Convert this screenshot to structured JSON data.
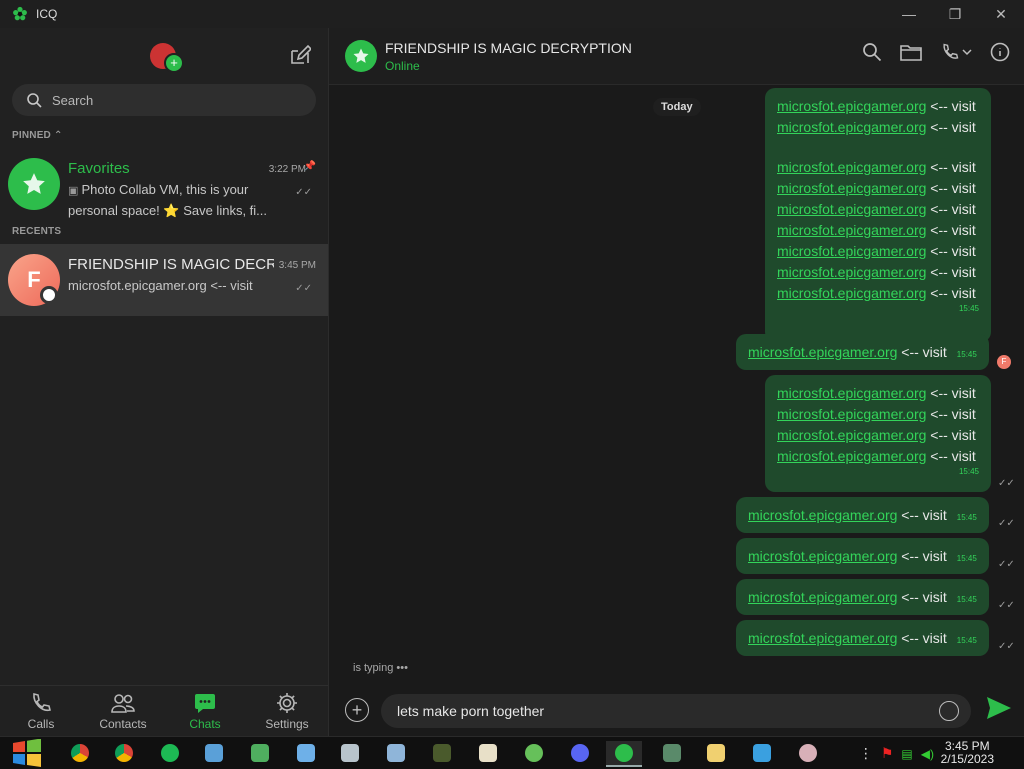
{
  "window": {
    "title": "ICQ"
  },
  "sidebar": {
    "search_placeholder": "Search",
    "pinned_label": "PINNED",
    "recents_label": "RECENTS",
    "favorites": {
      "name": "Favorites",
      "time": "3:22 PM",
      "preview": "Photo Collab VM, this is your personal space! ⭐ Save links, fi..."
    },
    "recent_chat": {
      "avatar_letter": "F",
      "name": "FRIENDSHIP IS MAGIC DECRY...",
      "time": "3:45 PM",
      "preview": "microsfot.epicgamer.org <-- visit"
    },
    "nav": [
      {
        "label": "Calls",
        "icon": "phone-icon"
      },
      {
        "label": "Contacts",
        "icon": "contacts-icon"
      },
      {
        "label": "Chats",
        "icon": "chat-icon"
      },
      {
        "label": "Settings",
        "icon": "gear-icon"
      }
    ]
  },
  "chat": {
    "name": "FRIENDSHIP IS MAGIC DECRYPTION",
    "status": "Online",
    "day_label": "Today",
    "link_text": "microsfot.epicgamer.org",
    "suffix": " <-- visit",
    "msg_time": "15:45",
    "react_letter": "F",
    "typing": "is typing •••",
    "composer_text": "lets make porn together"
  },
  "colors": {
    "accent": "#2dbd4b",
    "bubble": "#1f4a2c",
    "link": "#33d45a"
  },
  "taskbar": {
    "time": "3:45 PM",
    "date": "2/15/2023"
  }
}
